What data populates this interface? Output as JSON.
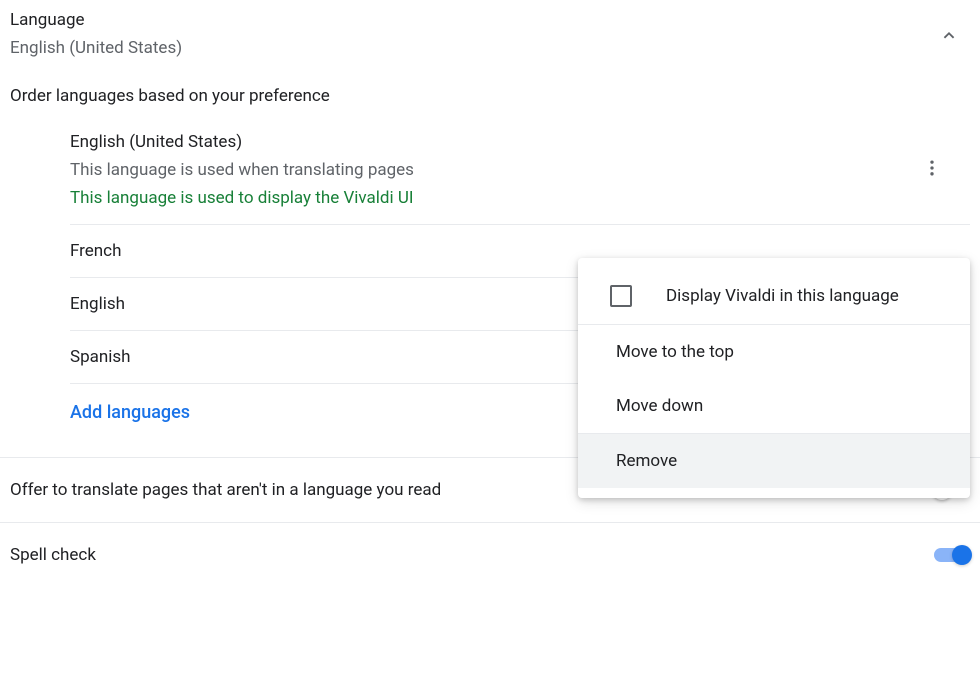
{
  "header": {
    "title": "Language",
    "subtitle": "English (United States)"
  },
  "order_text": "Order languages based on your preference",
  "languages": {
    "primary": {
      "name": "English (United States)",
      "sub": "This language is used when translating pages",
      "highlight": "This language is used to display the Vivaldi UI"
    },
    "others": [
      {
        "name": "French"
      },
      {
        "name": "English"
      },
      {
        "name": "Spanish"
      }
    ]
  },
  "add_languages_label": "Add languages",
  "settings": {
    "translate_offer": "Offer to translate pages that aren't in a language you read",
    "spell_check": "Spell check"
  },
  "dropdown": {
    "display_in_lang": "Display Vivaldi in this language",
    "move_top": "Move to the top",
    "move_down": "Move down",
    "remove": "Remove"
  }
}
